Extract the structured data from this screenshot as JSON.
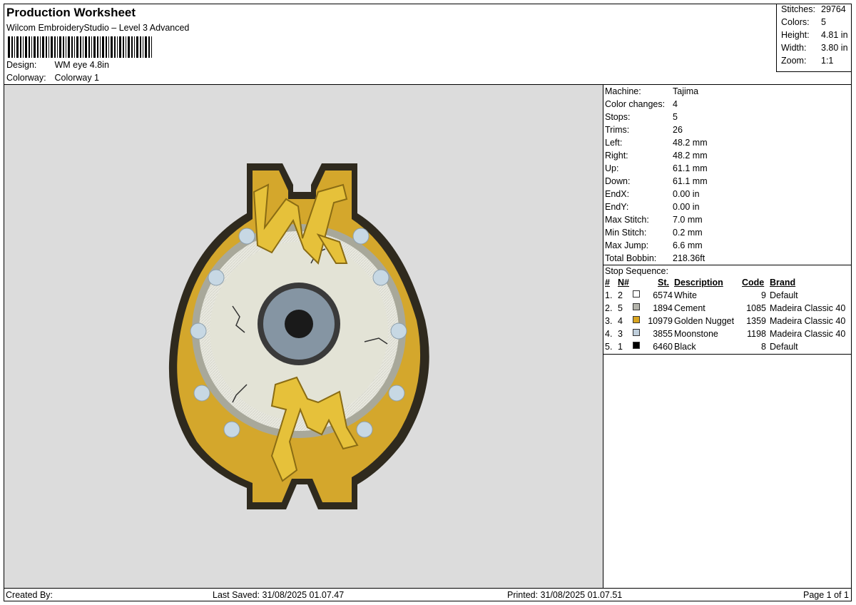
{
  "header": {
    "title": "Production Worksheet",
    "subtitle": "Wilcom EmbroideryStudio – Level 3 Advanced",
    "design_label": "Design:",
    "design_value": "WM eye 4.8in",
    "colorway_label": "Colorway:",
    "colorway_value": "Colorway 1"
  },
  "summary": [
    {
      "label": "Stitches:",
      "value": "29764"
    },
    {
      "label": "Colors:",
      "value": "5"
    },
    {
      "label": "Height:",
      "value": "4.81 in"
    },
    {
      "label": "Width:",
      "value": "3.80 in"
    },
    {
      "label": "Zoom:",
      "value": "1:1"
    }
  ],
  "params": [
    {
      "label": "Machine:",
      "value": "Tajima"
    },
    {
      "label": "Color changes:",
      "value": "4"
    },
    {
      "label": "Stops:",
      "value": "5"
    },
    {
      "label": "Trims:",
      "value": "26"
    },
    {
      "label": "Left:",
      "value": "48.2 mm"
    },
    {
      "label": "Right:",
      "value": "48.2 mm"
    },
    {
      "label": "Up:",
      "value": "61.1 mm"
    },
    {
      "label": "Down:",
      "value": "61.1 mm"
    },
    {
      "label": "EndX:",
      "value": "0.00 in"
    },
    {
      "label": "EndY:",
      "value": "0.00 in"
    },
    {
      "label": "Max Stitch:",
      "value": "7.0 mm"
    },
    {
      "label": "Min Stitch:",
      "value": "0.2 mm"
    },
    {
      "label": "Max Jump:",
      "value": "6.6 mm"
    },
    {
      "label": "Total Bobbin:",
      "value": "218.36ft"
    }
  ],
  "stops": {
    "title": "Stop Sequence:",
    "columns": [
      "#",
      "N#",
      "St.",
      "Description",
      "Code",
      "Brand"
    ],
    "rows": [
      {
        "num": "1.",
        "n": "2",
        "color": "#ffffff",
        "st": "6574",
        "desc": "White",
        "code": "9",
        "brand": "Default"
      },
      {
        "num": "2.",
        "n": "5",
        "color": "#b4b4ac",
        "st": "1894",
        "desc": "Cement",
        "code": "1085",
        "brand": "Madeira Classic 40"
      },
      {
        "num": "3.",
        "n": "4",
        "color": "#d9a520",
        "st": "10979",
        "desc": "Golden Nugget",
        "code": "1359",
        "brand": "Madeira Classic 40"
      },
      {
        "num": "4.",
        "n": "3",
        "color": "#c0cfdc",
        "st": "3855",
        "desc": "Moonstone",
        "code": "1198",
        "brand": "Madeira Classic 40"
      },
      {
        "num": "5.",
        "n": "1",
        "color": "#000000",
        "st": "6460",
        "desc": "Black",
        "code": "8",
        "brand": "Default"
      }
    ]
  },
  "footer": {
    "created": "Created By:",
    "saved": "Last Saved: 31/08/2025 01.07.47",
    "printed": "Printed: 31/08/2025 01.07.51",
    "page": "Page 1 of 1"
  }
}
